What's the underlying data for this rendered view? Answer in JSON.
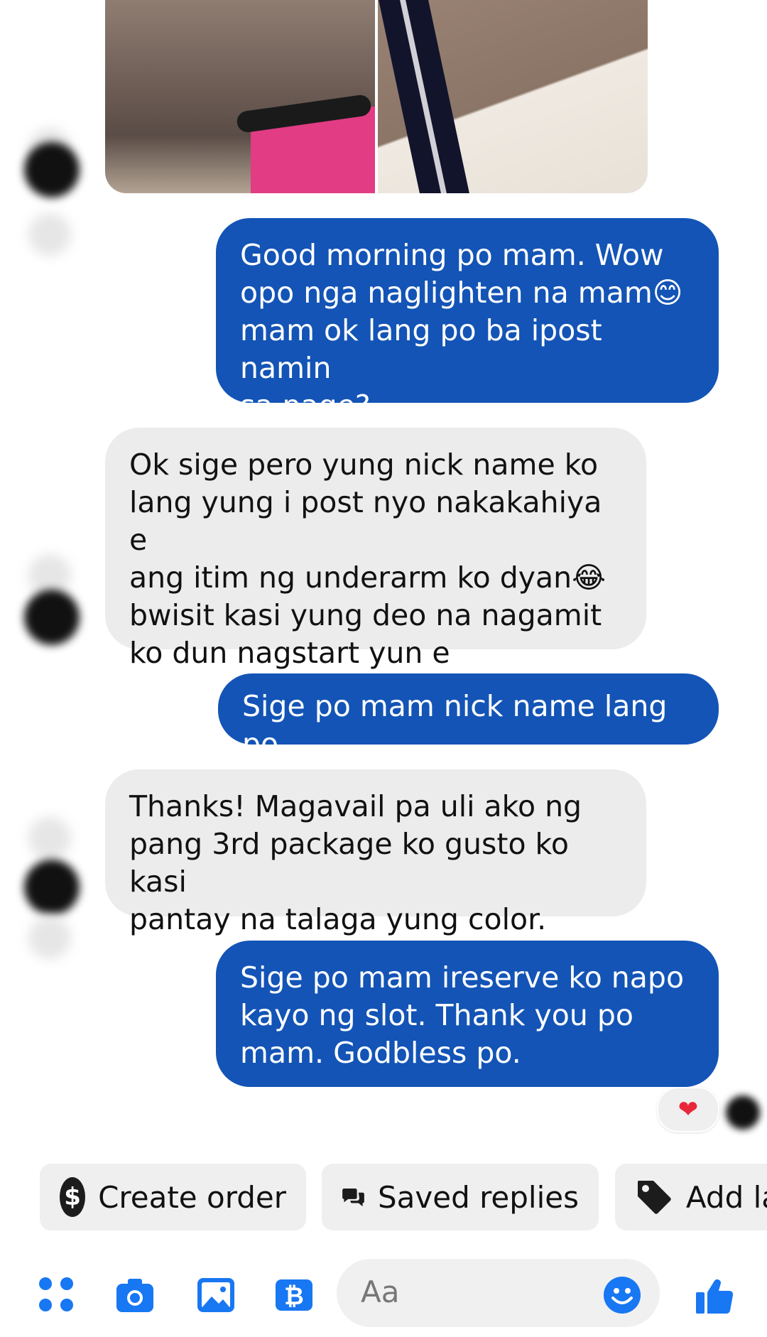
{
  "messages": [
    {
      "side": "out",
      "text": "Good morning po mam. Wow\nopo nga naglighten na mam😊\nmam ok lang po ba ipost namin\nsa page?"
    },
    {
      "side": "in",
      "text": "Ok sige pero yung nick name ko\nlang yung i post nyo nakakahiya e\nang itim ng underarm ko dyan😂\nbwisit kasi yung deo na nagamit\nko dun nagstart yun e"
    },
    {
      "side": "out",
      "text": "Sige po mam nick name lang po"
    },
    {
      "side": "in",
      "text": "Thanks! Magavail pa uli ako ng\npang 3rd package ko gusto ko kasi\npantay na talaga yung color."
    },
    {
      "side": "out",
      "text": "Sige po mam ireserve ko napo\nkayo ng slot. Thank you po\nmam. Godbless po."
    }
  ],
  "reaction": "❤",
  "quick_actions": {
    "create_order": "Create order",
    "saved_replies": "Saved replies",
    "add_label": "Add la"
  },
  "composer": {
    "placeholder": "Aa"
  },
  "colors": {
    "outgoing": "#1354b6",
    "incoming": "#ececec",
    "icon": "#1877f2"
  }
}
